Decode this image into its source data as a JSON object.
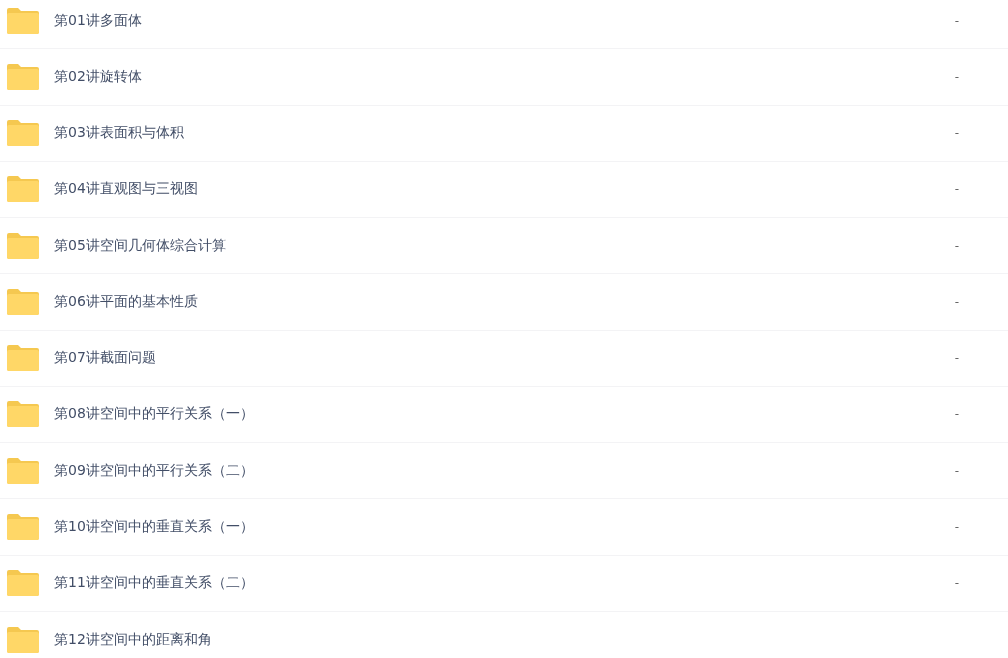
{
  "folders": [
    {
      "name": "第01讲多面体",
      "column_2": "-"
    },
    {
      "name": "第02讲旋转体",
      "column_2": "-"
    },
    {
      "name": "第03讲表面积与体积",
      "column_2": "-"
    },
    {
      "name": "第04讲直观图与三视图",
      "column_2": "-"
    },
    {
      "name": "第05讲空间几何体综合计算",
      "column_2": "-"
    },
    {
      "name": "第06讲平面的基本性质",
      "column_2": "-"
    },
    {
      "name": "第07讲截面问题",
      "column_2": "-"
    },
    {
      "name": "第08讲空间中的平行关系（一）",
      "column_2": "-"
    },
    {
      "name": "第09讲空间中的平行关系（二）",
      "column_2": "-"
    },
    {
      "name": "第10讲空间中的垂直关系（一）",
      "column_2": "-"
    },
    {
      "name": "第11讲空间中的垂直关系（二）",
      "column_2": "-"
    },
    {
      "name": "第12讲空间中的距离和角"
    }
  ]
}
